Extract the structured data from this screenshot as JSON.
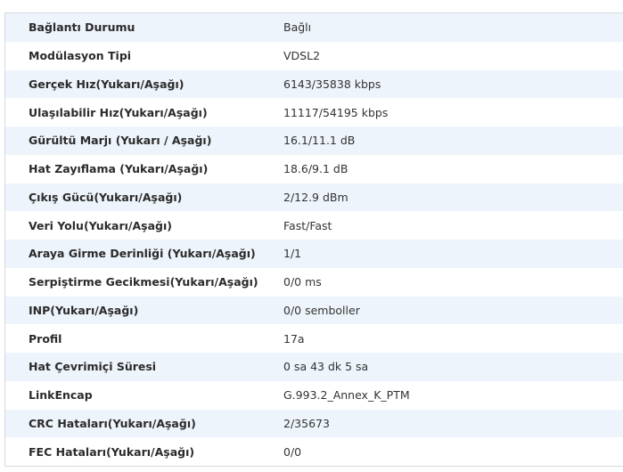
{
  "rows": [
    {
      "label": "Bağlantı Durumu",
      "value": "Bağlı"
    },
    {
      "label": "Modülasyon Tipi",
      "value": "VDSL2"
    },
    {
      "label": "Gerçek Hız(Yukarı/Aşağı)",
      "value": "6143/35838 kbps"
    },
    {
      "label": "Ulaşılabilir Hız(Yukarı/Aşağı)",
      "value": "11117/54195 kbps"
    },
    {
      "label": "Gürültü Marjı (Yukarı / Aşağı)",
      "value": "16.1/11.1 dB"
    },
    {
      "label": "Hat Zayıflama (Yukarı/Aşağı)",
      "value": "18.6/9.1 dB"
    },
    {
      "label": "Çıkış Gücü(Yukarı/Aşağı)",
      "value": "2/12.9 dBm"
    },
    {
      "label": "Veri Yolu(Yukarı/Aşağı)",
      "value": "Fast/Fast"
    },
    {
      "label": "Araya Girme Derinliği (Yukarı/Aşağı)",
      "value": "1/1"
    },
    {
      "label": "Serpiştirme Gecikmesi(Yukarı/Aşağı)",
      "value": "0/0 ms"
    },
    {
      "label": "INP(Yukarı/Aşağı)",
      "value": "0/0 semboller"
    },
    {
      "label": "Profil",
      "value": "17a"
    },
    {
      "label": "Hat Çevrimiçi Süresi",
      "value": "0 sa 43 dk 5 sa"
    },
    {
      "label": "LinkEncap",
      "value": "G.993.2_Annex_K_PTM"
    },
    {
      "label": "CRC Hataları(Yukarı/Aşağı)",
      "value": "2/35673"
    },
    {
      "label": "FEC Hataları(Yukarı/Aşağı)",
      "value": "0/0"
    }
  ],
  "colors": {
    "row_stripe": "#eef4fb",
    "row_plain": "#ffffff",
    "border": "#d6d9de",
    "label_text": "#2b2b2b",
    "value_text": "#333333"
  }
}
